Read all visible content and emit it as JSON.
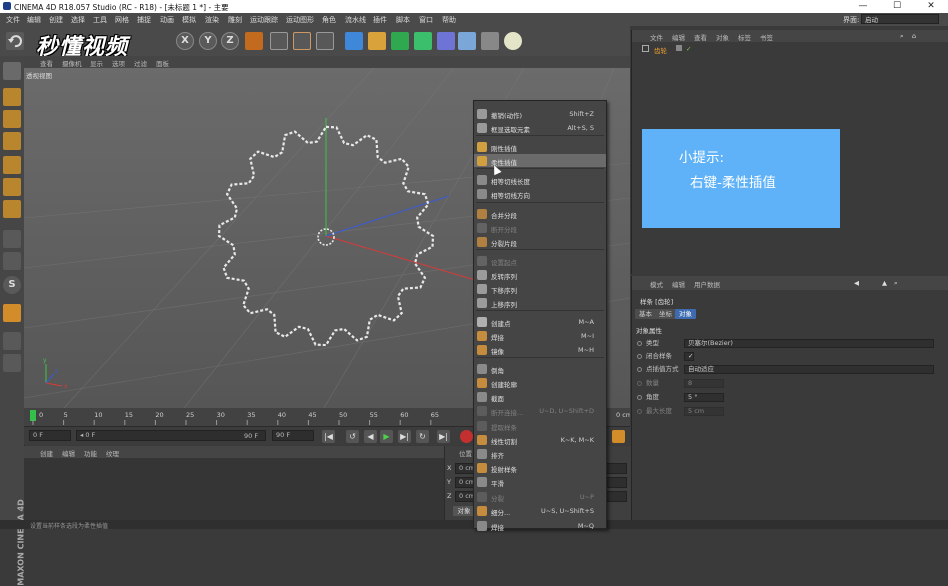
{
  "window": {
    "title": "CINEMA 4D R18.057 Studio (RC - R18) - [未标题 1 *] - 主要",
    "controls": {
      "minimize": "—",
      "maximize": "☐",
      "close": "✕"
    }
  },
  "menubar": {
    "items": [
      "文件",
      "编辑",
      "创建",
      "选择",
      "工具",
      "网格",
      "捕捉",
      "动画",
      "模拟",
      "渲染",
      "雕刻",
      "运动跟踪",
      "运动图形",
      "角色",
      "流水线",
      "插件",
      "脚本",
      "窗口",
      "帮助"
    ],
    "interface_label": "界面:",
    "interface_value": "启动"
  },
  "watermark": "秒懂视频",
  "toolbar": {
    "x": "X",
    "y": "Y",
    "z": "Z"
  },
  "viewport": {
    "menu": [
      "查看",
      "摄像机",
      "显示",
      "选项",
      "过滤",
      "面板"
    ],
    "label": "透视视图",
    "axis": {
      "x": "x",
      "y": "y",
      "z": "z"
    }
  },
  "timeline": {
    "ticks": [
      "0",
      "5",
      "10",
      "15",
      "20",
      "25",
      "30",
      "35",
      "40",
      "45",
      "50",
      "55",
      "60",
      "65"
    ],
    "end_label": "90 F",
    "frame_start": "0 F",
    "frame_current": "◂ 0 F",
    "frame_end": "90 F",
    "frame_max": "90 F",
    "right_readout": "0 cm"
  },
  "material": {
    "menu": [
      "创建",
      "编辑",
      "功能",
      "纹理"
    ]
  },
  "coords": {
    "header": "位置",
    "rows": [
      {
        "axis": "X",
        "value": "0 cm"
      },
      {
        "axis": "Y",
        "value": "0 cm"
      },
      {
        "axis": "Z",
        "value": "0 cm"
      }
    ],
    "button": "对象"
  },
  "status": "设置当前样条选段为柔性插值",
  "objects": {
    "menu": [
      "文件",
      "编辑",
      "查看",
      "对象",
      "标签",
      "书签"
    ],
    "item": "齿轮"
  },
  "attributes": {
    "menu": [
      "模式",
      "编辑",
      "用户数据"
    ],
    "object_title": "样条 [齿轮]",
    "tabs": [
      "基本",
      "坐标",
      "对象"
    ],
    "section": "对象属性",
    "props": [
      {
        "label": "类型",
        "value": "贝塞尔(Bezier)"
      },
      {
        "label": "闭合样条",
        "value": "✓"
      },
      {
        "label": "点插值方式",
        "value": "自动适应"
      },
      {
        "label": "数量",
        "value": "8"
      },
      {
        "label": "角度",
        "value": "5 °"
      },
      {
        "label": "最大长度",
        "value": "5 cm"
      }
    ]
  },
  "tip": {
    "line1": "小提示:",
    "line2": "右键-柔性插值"
  },
  "context_menu": {
    "items": [
      {
        "label": "撤销(动作)",
        "shortcut": "Shift+Z",
        "disabled": false,
        "icon": "undo-icon"
      },
      {
        "label": "框显选取元素",
        "shortcut": "Alt+S, S",
        "disabled": false,
        "icon": "frame-icon"
      },
      {
        "label": "刚性插值",
        "shortcut": "",
        "disabled": false,
        "icon": "hard-interp-icon"
      },
      {
        "label": "柔性插值",
        "shortcut": "",
        "disabled": false,
        "highlighted": true,
        "icon": "soft-interp-icon"
      },
      {
        "label": "相等切线长度",
        "shortcut": "",
        "disabled": false,
        "icon": "tangent-length-icon"
      },
      {
        "label": "相等切线方向",
        "shortcut": "",
        "disabled": false,
        "icon": "tangent-direction-icon"
      },
      {
        "label": "合并分段",
        "shortcut": "",
        "disabled": false,
        "icon": "join-segment-icon"
      },
      {
        "label": "断开分段",
        "shortcut": "",
        "disabled": true,
        "icon": "break-segment-icon"
      },
      {
        "label": "分裂片段",
        "shortcut": "",
        "disabled": false,
        "icon": "explode-segment-icon"
      },
      {
        "label": "设置起点",
        "shortcut": "",
        "disabled": true,
        "icon": "set-first-point-icon"
      },
      {
        "label": "反转序列",
        "shortcut": "",
        "disabled": false,
        "icon": "reverse-sequence-icon"
      },
      {
        "label": "下移序列",
        "shortcut": "",
        "disabled": false,
        "icon": "move-down-sequence-icon"
      },
      {
        "label": "上移序列",
        "shortcut": "",
        "disabled": false,
        "icon": "move-up-sequence-icon"
      },
      {
        "label": "创建点",
        "shortcut": "M~A",
        "disabled": false,
        "icon": "create-point-icon"
      },
      {
        "label": "焊接",
        "shortcut": "M~I",
        "disabled": false,
        "icon": "weld-icon"
      },
      {
        "label": "镜像",
        "shortcut": "M~H",
        "disabled": false,
        "icon": "mirror-icon"
      },
      {
        "label": "倒角",
        "shortcut": "",
        "disabled": false,
        "icon": "chamfer-icon"
      },
      {
        "label": "创建轮廓",
        "shortcut": "",
        "disabled": false,
        "icon": "create-outline-icon"
      },
      {
        "label": "截面",
        "shortcut": "",
        "disabled": false,
        "icon": "cross-section-icon"
      },
      {
        "label": "断开连接...",
        "shortcut": "U~D, U~Shift+D",
        "disabled": true,
        "icon": "disconnect-icon"
      },
      {
        "label": "提取样条",
        "shortcut": "",
        "disabled": true,
        "icon": "extract-spline-icon"
      },
      {
        "label": "线性切割",
        "shortcut": "K~K, M~K",
        "disabled": false,
        "icon": "line-cut-icon"
      },
      {
        "label": "排齐",
        "shortcut": "",
        "disabled": false,
        "icon": "line-up-icon"
      },
      {
        "label": "投射样条",
        "shortcut": "",
        "disabled": false,
        "icon": "project-spline-icon"
      },
      {
        "label": "平滑",
        "shortcut": "",
        "disabled": false,
        "icon": "smooth-icon"
      },
      {
        "label": "分裂",
        "shortcut": "U~P",
        "disabled": true,
        "icon": "split-icon"
      },
      {
        "label": "细分...",
        "shortcut": "U~S, U~Shift+S",
        "disabled": false,
        "icon": "subdivide-icon"
      },
      {
        "label": "焊接",
        "shortcut": "M~Q",
        "disabled": false,
        "icon": "weld2-icon"
      }
    ]
  },
  "colors": {
    "accent_orange": "#e38a1e",
    "tip_blue": "#5fb2f7",
    "object_green": "#7fc85a",
    "axis_red": "#d83a3a",
    "axis_green": "#3fc34a",
    "axis_blue": "#3a5bd8"
  }
}
